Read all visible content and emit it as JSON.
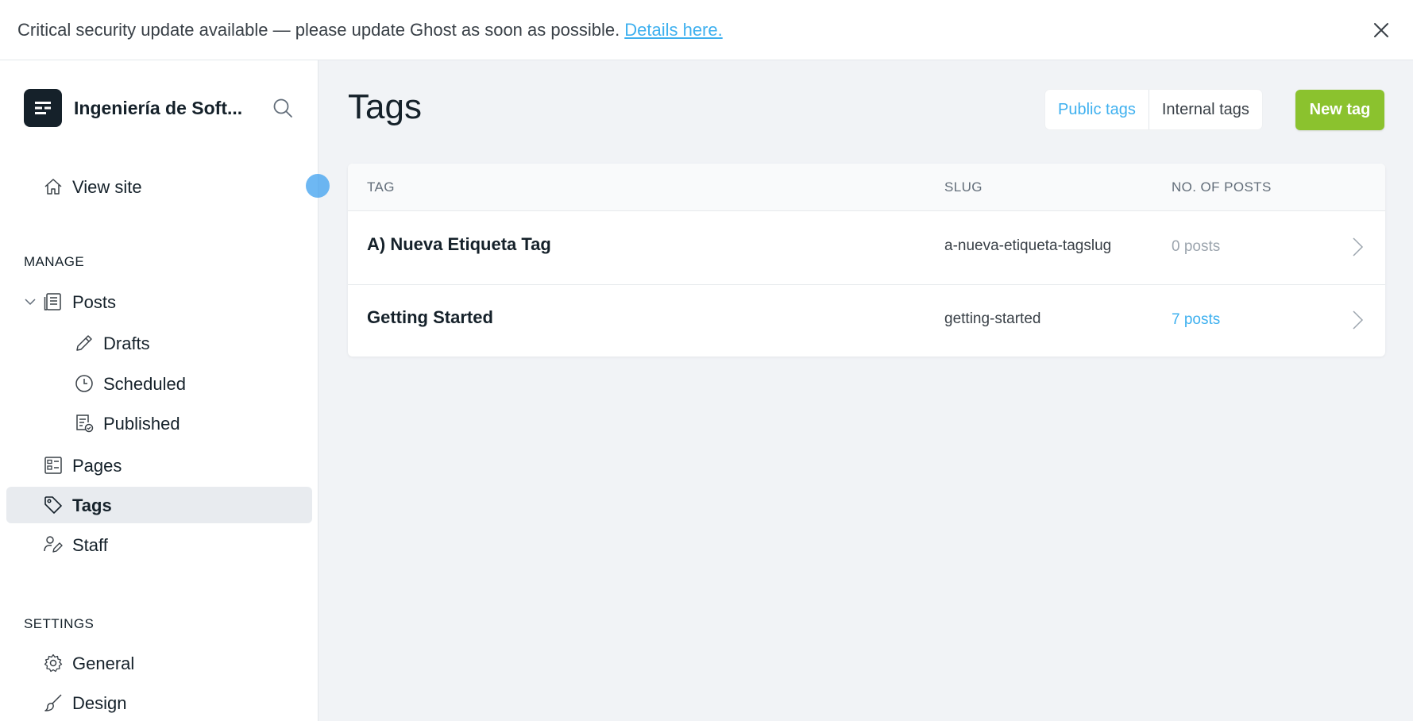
{
  "banner": {
    "text": "Critical security update available — please update Ghost as soon as possible.",
    "link": "Details here."
  },
  "brand": {
    "name": "Ingeniería de Soft..."
  },
  "nav": {
    "view_site": "View site",
    "manage_title": "MANAGE",
    "posts": "Posts",
    "drafts": "Drafts",
    "scheduled": "Scheduled",
    "published": "Published",
    "pages": "Pages",
    "tags": "Tags",
    "staff": "Staff",
    "settings_title": "SETTINGS",
    "general": "General",
    "design": "Design"
  },
  "main": {
    "title": "Tags",
    "filters": {
      "public": "Public tags",
      "internal": "Internal tags"
    },
    "new_tag": "New tag",
    "columns": {
      "tag": "TAG",
      "slug": "SLUG",
      "posts": "NO. OF POSTS"
    },
    "rows": [
      {
        "name": "A) Nueva Etiqueta Tag",
        "slug": "a-nueva-etiqueta-tagslug",
        "posts": "0 posts"
      },
      {
        "name": "Getting Started",
        "slug": "getting-started",
        "posts": "7 posts"
      }
    ]
  },
  "colors": {
    "accent": "#3eb0ef",
    "primary_button": "#8bc22e",
    "sidebar_active": "#e8ebef"
  },
  "icons": [
    "close-icon",
    "search-icon",
    "home-icon",
    "chevron-down-icon",
    "posts-icon",
    "pencil-icon",
    "clock-icon",
    "published-icon",
    "pages-icon",
    "tag-icon",
    "staff-icon",
    "gear-icon",
    "brush-icon",
    "chevron-right-icon"
  ]
}
